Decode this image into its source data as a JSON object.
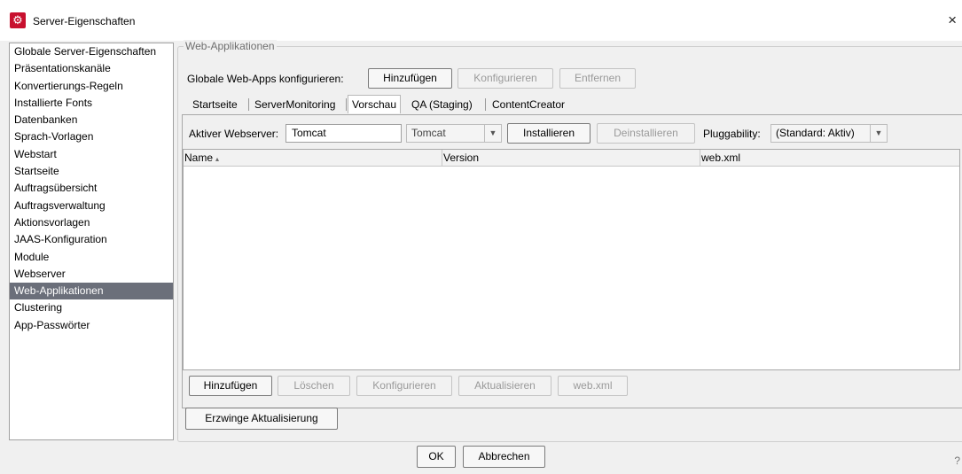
{
  "window": {
    "title": "Server-Eigenschaften",
    "close": "×"
  },
  "sidebar": {
    "items": [
      {
        "label": "Globale Server-Eigenschaften"
      },
      {
        "label": "Präsentationskanäle"
      },
      {
        "label": "Konvertierungs-Regeln"
      },
      {
        "label": "Installierte Fonts"
      },
      {
        "label": "Datenbanken"
      },
      {
        "label": "Sprach-Vorlagen"
      },
      {
        "label": "Webstart"
      },
      {
        "label": "Startseite"
      },
      {
        "label": "Auftragsübersicht"
      },
      {
        "label": "Auftragsverwaltung"
      },
      {
        "label": "Aktionsvorlagen"
      },
      {
        "label": "JAAS-Konfiguration"
      },
      {
        "label": "Module"
      },
      {
        "label": "Webserver"
      },
      {
        "label": "Web-Applikationen"
      },
      {
        "label": "Clustering"
      },
      {
        "label": "App-Passwörter"
      }
    ],
    "selected": "Web-Applikationen"
  },
  "group": {
    "title": "Web-Applikationen"
  },
  "global_apps": {
    "label": "Globale Web-Apps konfigurieren:",
    "add": "Hinzufügen",
    "configure": "Konfigurieren",
    "remove": "Entfernen"
  },
  "tabs": [
    {
      "label": "Startseite"
    },
    {
      "label": "ServerMonitoring"
    },
    {
      "label": "Vorschau"
    },
    {
      "label": "QA (Staging)"
    },
    {
      "label": "ContentCreator"
    }
  ],
  "active_tab": "Vorschau",
  "webserver": {
    "label": "Aktiver Webserver:",
    "value": "Tomcat",
    "select_value": "Tomcat",
    "install": "Installieren",
    "uninstall": "Deinstallieren",
    "pluggability_label": "Pluggability:",
    "pluggability_value": "(Standard: Aktiv)"
  },
  "table": {
    "columns": [
      "Name",
      "Version",
      "web.xml"
    ],
    "rows": []
  },
  "table_buttons": {
    "add": "Hinzufügen",
    "delete": "Löschen",
    "configure": "Konfigurieren",
    "update": "Aktualisieren",
    "webxml": "web.xml"
  },
  "force_update": "Erzwinge Aktualisierung",
  "footer": {
    "ok": "OK",
    "cancel": "Abbrechen",
    "help": "?"
  }
}
